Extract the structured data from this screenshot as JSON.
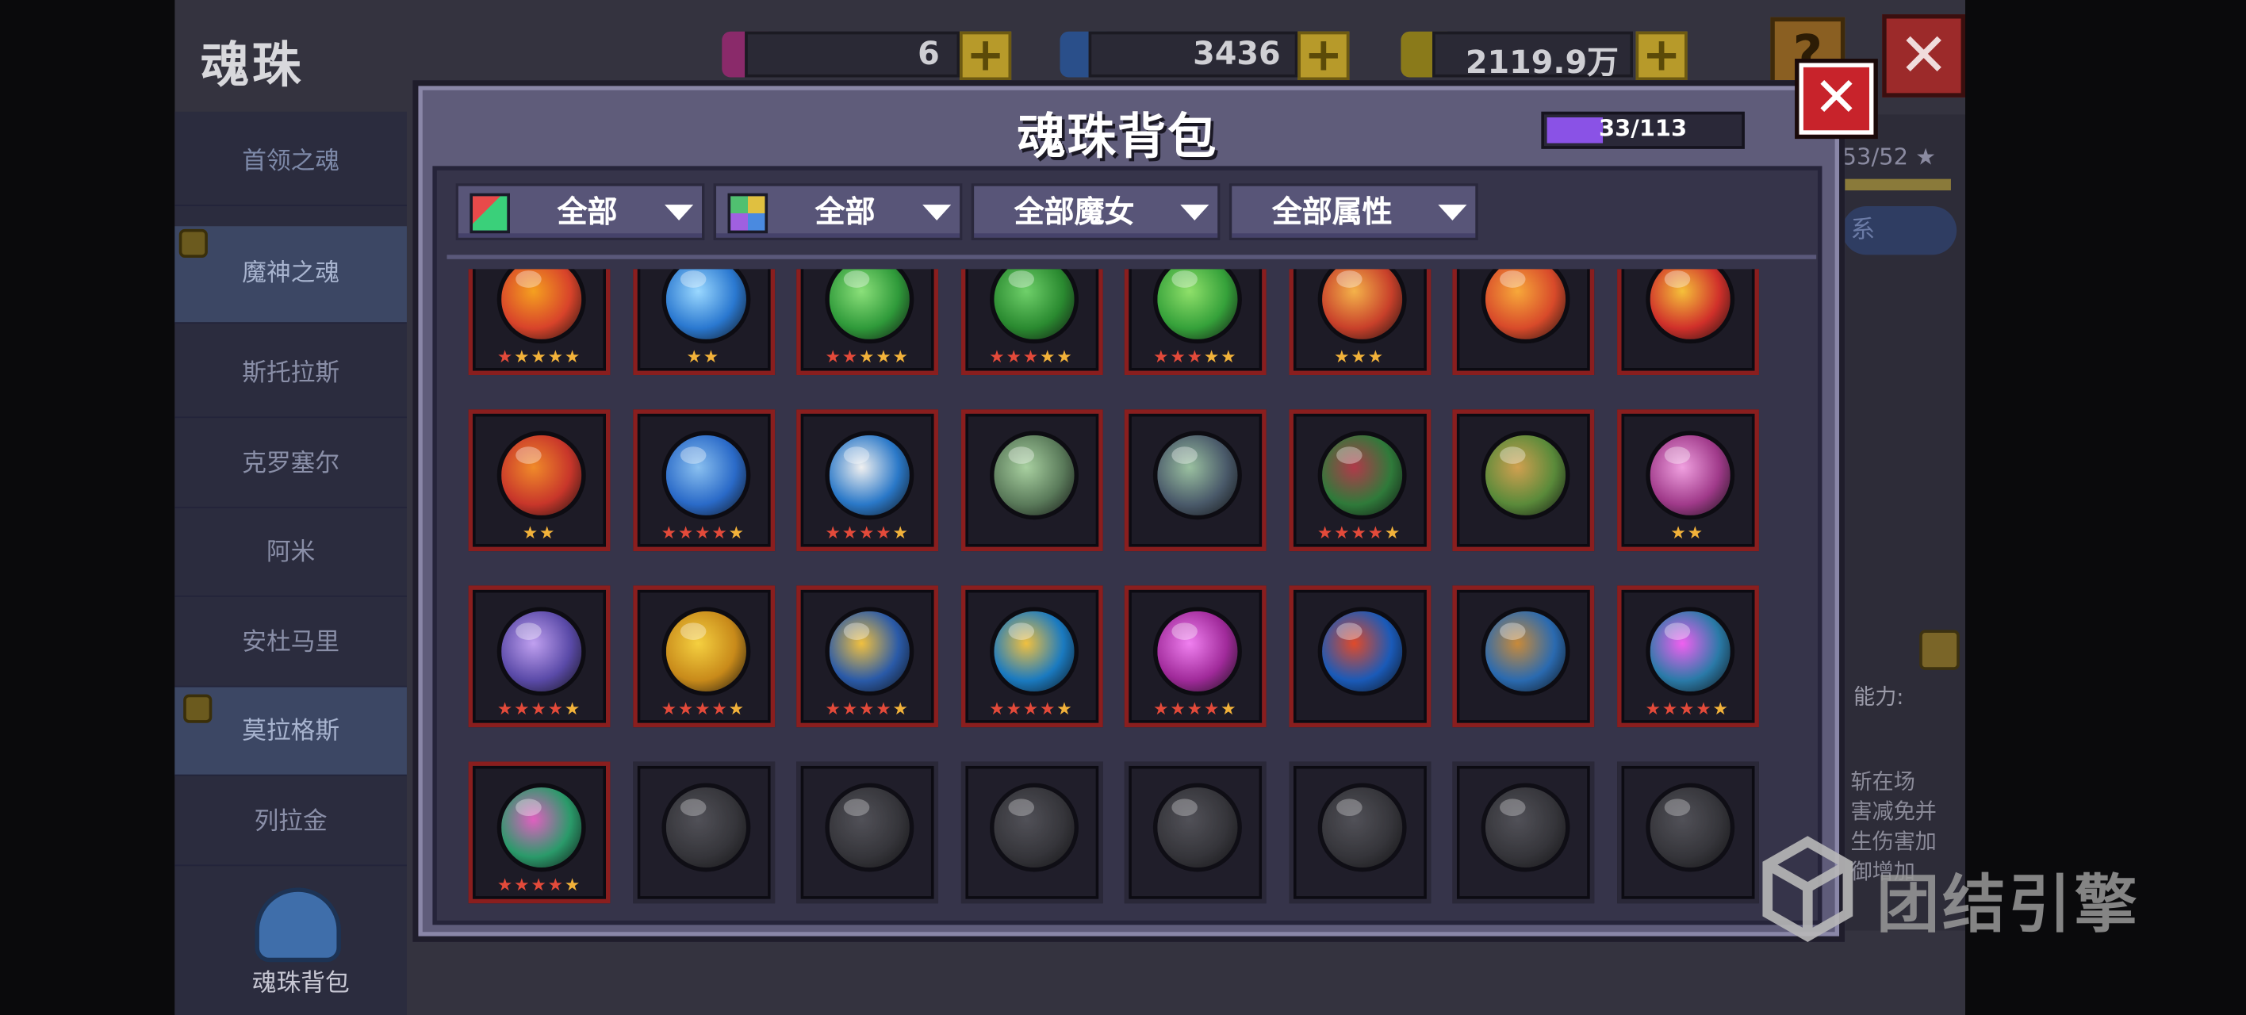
{
  "header": {
    "title": "魂珠",
    "resources": [
      {
        "icon": "purple-gem-icon",
        "value": "6",
        "color": "#8a2a6a"
      },
      {
        "icon": "blue-gem-icon",
        "value": "3436",
        "color": "#2a4f8a"
      },
      {
        "icon": "gold-coin-icon",
        "value": "2119.9万",
        "color": "#8a7a1a"
      }
    ],
    "help_label": "?",
    "close_label": "✕"
  },
  "sidebar": {
    "items": [
      {
        "label": "首领之魂"
      },
      {
        "label": "魔神之魂"
      },
      {
        "label": "斯托拉斯"
      },
      {
        "label": "克罗塞尔"
      },
      {
        "label": "阿米"
      },
      {
        "label": "安杜马里"
      },
      {
        "label": "莫拉格斯"
      },
      {
        "label": "列拉金"
      }
    ],
    "bag_label": "魂珠背包"
  },
  "right_panel": {
    "stars": "53/52 ★",
    "pill": "系",
    "ability_label": "能力:",
    "desc_lines": [
      "斩在场",
      "害减免并",
      "生伤害加",
      "御增加"
    ]
  },
  "modal": {
    "title": "魂珠背包",
    "capacity": "33/113",
    "capacity_fraction": 0.29,
    "close_label": "✕",
    "filters": [
      {
        "label": "全部",
        "icon": "rarity-color-icon"
      },
      {
        "label": "全部",
        "icon": "element-grid-icon"
      },
      {
        "label": "全部魔女",
        "icon": ""
      },
      {
        "label": "全部属性",
        "icon": ""
      }
    ],
    "orbs": [
      {
        "name": "flame-sword-orb",
        "color": "#d8432a",
        "glow": "#f5a020",
        "stars": 5,
        "red": 1
      },
      {
        "name": "ice-axe-orb",
        "color": "#2a78d0",
        "glow": "#9ad8ff",
        "stars": 2,
        "red": 0
      },
      {
        "name": "green-rune-orb",
        "color": "#2f9a3a",
        "glow": "#8be07a",
        "stars": 5,
        "red": 2
      },
      {
        "name": "green-cross-orb",
        "color": "#2a8a30",
        "glow": "#6fd06a",
        "stars": 5,
        "red": 3
      },
      {
        "name": "green-crescent-orb",
        "color": "#35a13a",
        "glow": "#8fe06a",
        "stars": 5,
        "red": 3
      },
      {
        "name": "fire-rune-orb",
        "color": "#c8402a",
        "glow": "#f4b24a",
        "stars": 3,
        "red": 0
      },
      {
        "name": "fire-axe-orb",
        "color": "#d84a2a",
        "glow": "#f7a83a",
        "stars": 0,
        "red": 0
      },
      {
        "name": "fire-leaf-orb",
        "color": "#d0302a",
        "glow": "#f5c03a",
        "stars": 0,
        "red": 0
      },
      {
        "name": "crimson-blade-orb",
        "color": "#c8362a",
        "glow": "#f08a2a",
        "stars": 2,
        "red": 0
      },
      {
        "name": "blue-shell-orb",
        "color": "#2a6ac8",
        "glow": "#8ac0f0",
        "stars": 5,
        "red": 4
      },
      {
        "name": "white-pearl-orb",
        "color": "#2a78c8",
        "glow": "#f0f0f0",
        "stars": 5,
        "red": 4
      },
      {
        "name": "green-star-orb",
        "color": "#5a7a5a",
        "glow": "#a8d0a0",
        "stars": 0,
        "red": 0
      },
      {
        "name": "green-violet-orb",
        "color": "#4a5a6a",
        "glow": "#9ac0a0",
        "stars": 0,
        "red": 0
      },
      {
        "name": "forest-beast-orb",
        "color": "#2f7a3a",
        "glow": "#b03a4a",
        "stars": 5,
        "red": 4
      },
      {
        "name": "jungle-monkey-orb",
        "color": "#5a8a3a",
        "glow": "#d0a050",
        "stars": 0,
        "red": 0
      },
      {
        "name": "pink-crystal-orb",
        "color": "#a03a8a",
        "glow": "#f0a0e0",
        "stars": 2,
        "red": 0
      },
      {
        "name": "violet-flower-orb",
        "color": "#5a4aa8",
        "glow": "#c0a0f0",
        "stars": 5,
        "red": 4
      },
      {
        "name": "golden-beast-orb",
        "color": "#c88a1a",
        "glow": "#f5d040",
        "stars": 5,
        "red": 4
      },
      {
        "name": "ice-crown-orb",
        "color": "#2a5aa8",
        "glow": "#f0c040",
        "stars": 5,
        "red": 4
      },
      {
        "name": "sapphire-ring-orb",
        "color": "#1a7ac0",
        "glow": "#f0c040",
        "stars": 5,
        "red": 4
      },
      {
        "name": "magenta-sphere-orb",
        "color": "#a02a9a",
        "glow": "#f080f0",
        "stars": 5,
        "red": 4
      },
      {
        "name": "blue-cannon-orb",
        "color": "#1a5ab8",
        "glow": "#e04a2a",
        "stars": 0,
        "red": 0
      },
      {
        "name": "monkey-king-orb",
        "color": "#2a6ab0",
        "glow": "#c88a3a",
        "stars": 0,
        "red": 0
      },
      {
        "name": "cyan-ice-orb",
        "color": "#2a7aa8",
        "glow": "#f060f0",
        "stars": 5,
        "red": 4
      },
      {
        "name": "emerald-cube-orb",
        "color": "#2a9a6a",
        "glow": "#e060c0",
        "stars": 5,
        "red": 4
      },
      {
        "name": "locked-beast-slot",
        "color": "#3a3a3e",
        "glow": "#5a5a60",
        "stars": 0,
        "red": 0,
        "locked": true
      },
      {
        "name": "locked-dragon-slot",
        "color": "#3a3a3e",
        "glow": "#5a5a60",
        "stars": 0,
        "red": 0,
        "locked": true
      },
      {
        "name": "locked-book-slot",
        "color": "#3a3a3e",
        "glow": "#5a5a60",
        "stars": 0,
        "red": 0,
        "locked": true
      },
      {
        "name": "locked-sword-slot",
        "color": "#3a3a3e",
        "glow": "#5a5a60",
        "stars": 0,
        "red": 0,
        "locked": true
      },
      {
        "name": "locked-rune-slot",
        "color": "#3a3a3e",
        "glow": "#5a5a60",
        "stars": 0,
        "red": 0,
        "locked": true
      },
      {
        "name": "locked-key-slot",
        "color": "#3a3a3e",
        "glow": "#5a5a60",
        "stars": 0,
        "red": 0,
        "locked": true
      },
      {
        "name": "locked-claw-slot",
        "color": "#3a3a3e",
        "glow": "#5a5a60",
        "stars": 0,
        "red": 0,
        "locked": true
      }
    ]
  },
  "watermark": {
    "text": "团结引擎"
  },
  "colors": {
    "accent_red": "#c8232b",
    "cell_border": "#8a1e1e",
    "capacity_fill": "#8a52e6"
  }
}
